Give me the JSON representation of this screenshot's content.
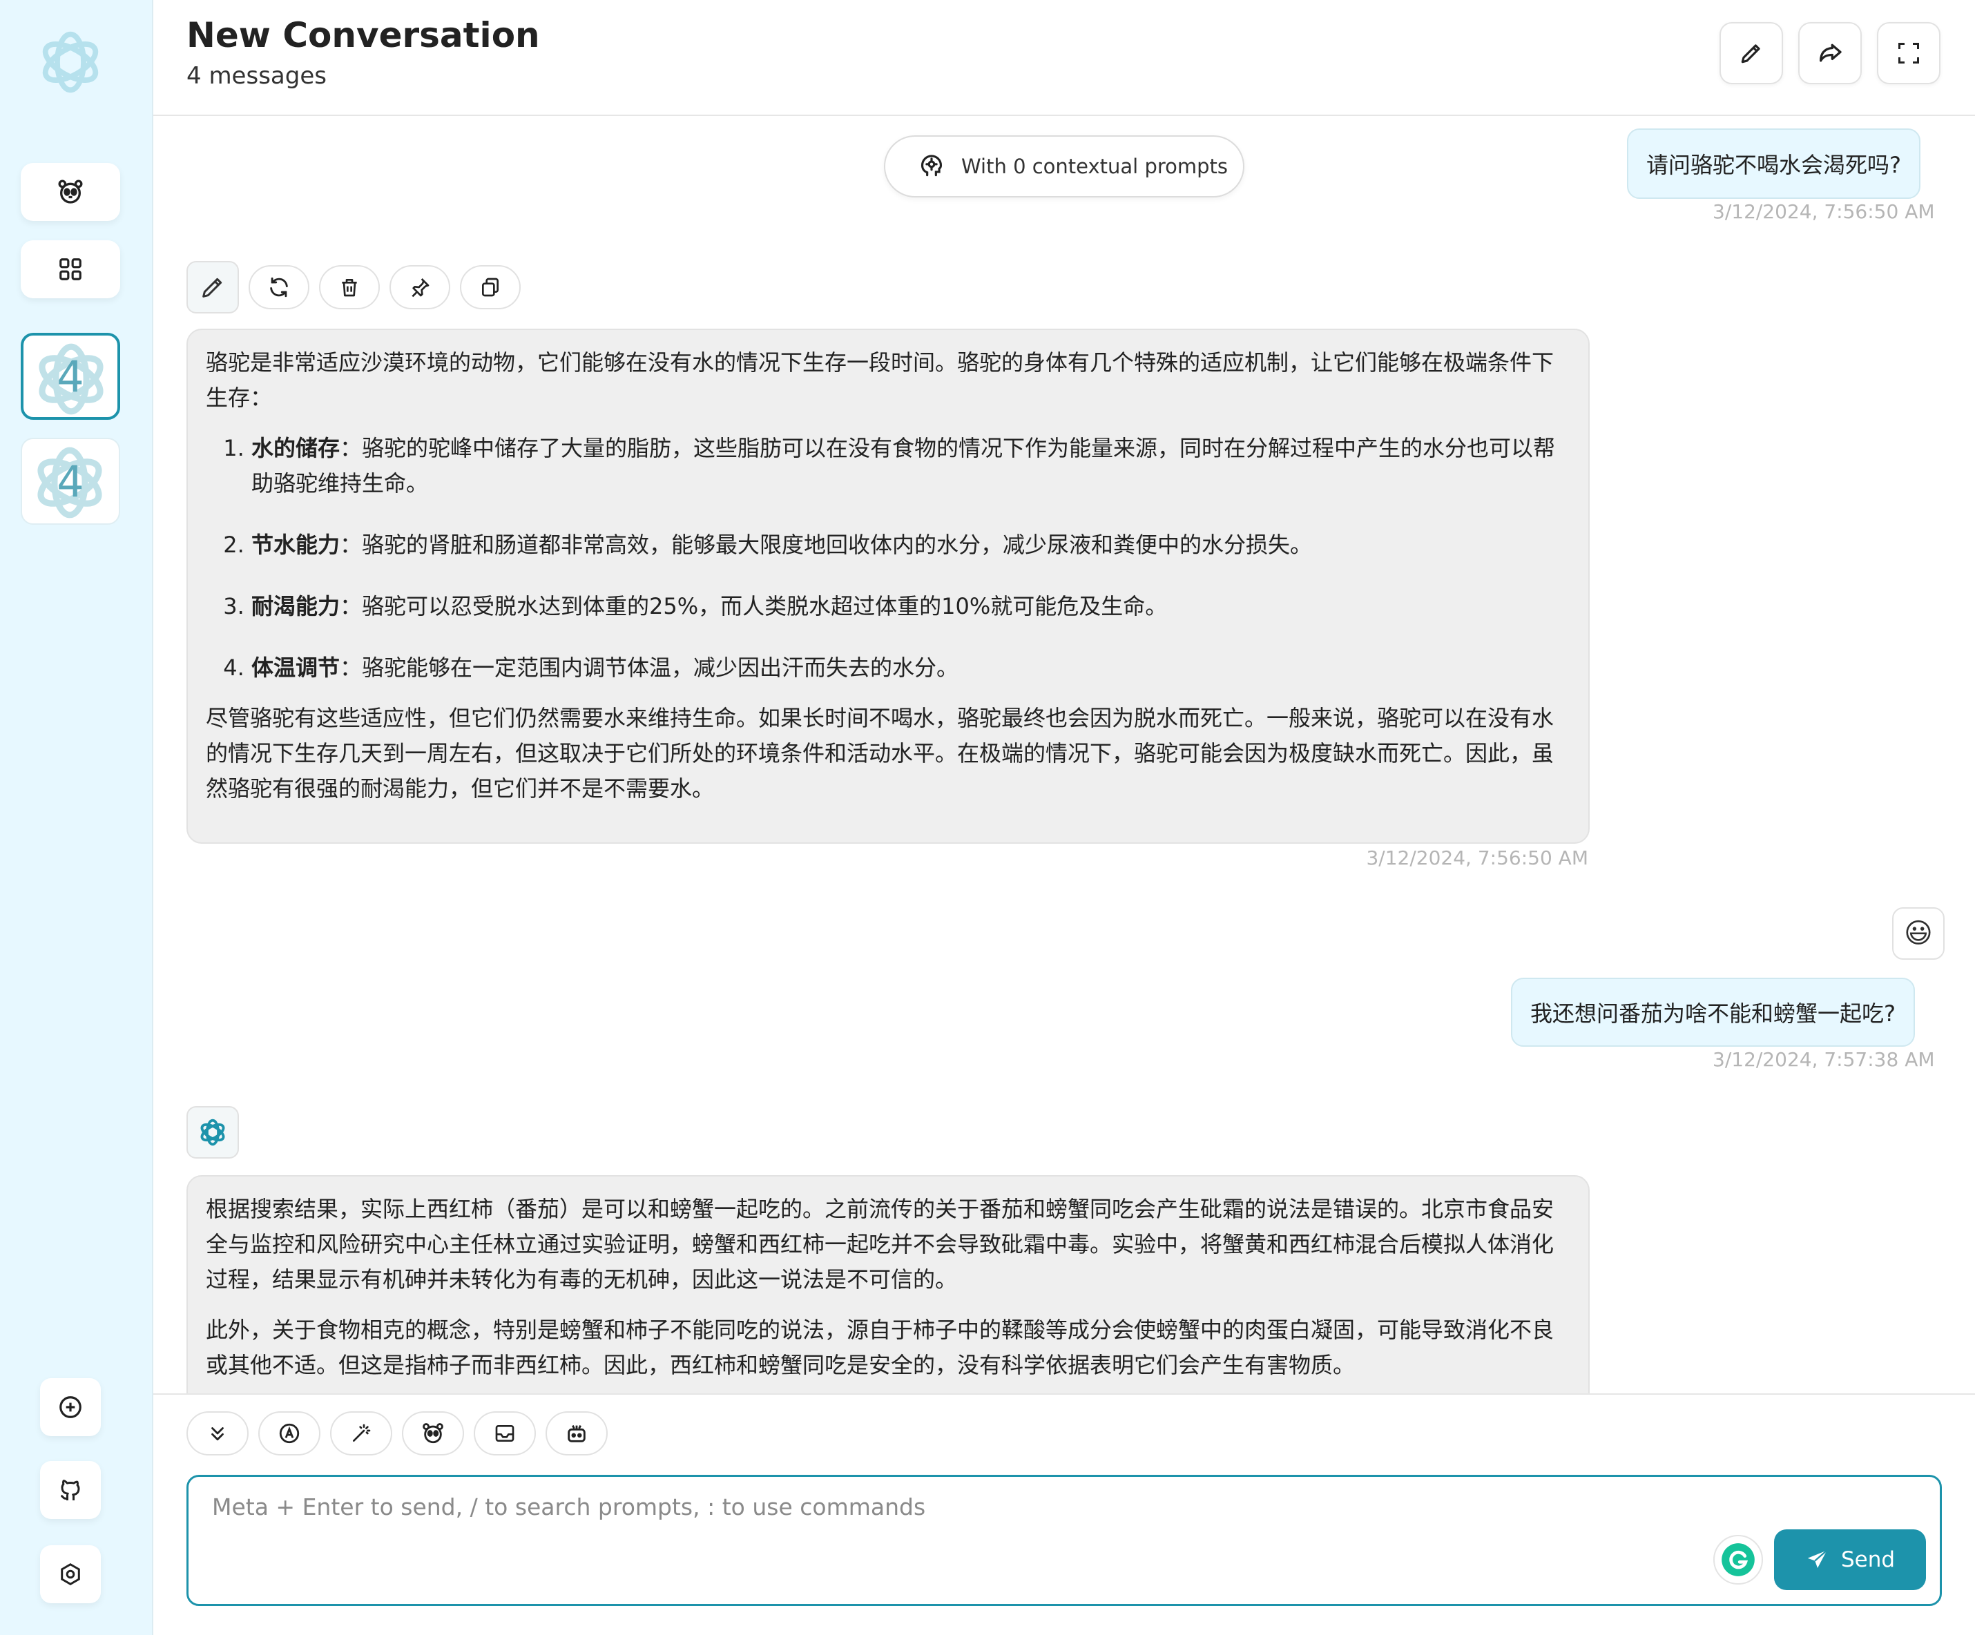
{
  "header": {
    "title": "New Conversation",
    "subtitle": "4 messages"
  },
  "sidebar": {
    "cards": [
      {
        "count": "4",
        "active": true
      },
      {
        "count": "4",
        "active": false
      }
    ]
  },
  "context": {
    "label": "With 0 contextual prompts"
  },
  "messages": [
    {
      "role": "user",
      "text": "请问骆驼不喝水会渴死吗?",
      "time": "3/12/2024, 7:56:50 AM"
    },
    {
      "role": "assistant",
      "intro": "骆驼是非常适应沙漠环境的动物，它们能够在没有水的情况下生存一段时间。骆驼的身体有几个特殊的适应机制，让它们能够在极端条件下生存：",
      "items": [
        {
          "title": "水的储存",
          "text": "：骆驼的驼峰中储存了大量的脂肪，这些脂肪可以在没有食物的情况下作为能量来源，同时在分解过程中产生的水分也可以帮助骆驼维持生命。"
        },
        {
          "title": "节水能力",
          "text": "：骆驼的肾脏和肠道都非常高效，能够最大限度地回收体内的水分，减少尿液和粪便中的水分损失。"
        },
        {
          "title": "耐渴能力",
          "text": "：骆驼可以忍受脱水达到体重的25%，而人类脱水超过体重的10%就可能危及生命。"
        },
        {
          "title": "体温调节",
          "text": "：骆驼能够在一定范围内调节体温，减少因出汗而失去的水分。"
        }
      ],
      "outro": "尽管骆驼有这些适应性，但它们仍然需要水来维持生命。如果长时间不喝水，骆驼最终也会因为脱水而死亡。一般来说，骆驼可以在没有水的情况下生存几天到一周左右，但这取决于它们所处的环境条件和活动水平。在极端的情况下，骆驼可能会因为极度缺水而死亡。因此，虽然骆驼有很强的耐渴能力，但它们并不是不需要水。",
      "time": "3/12/2024, 7:56:50 AM"
    },
    {
      "role": "user",
      "emoji": "😃",
      "text": "我还想问番茄为啥不能和螃蟹一起吃?",
      "time": "3/12/2024, 7:57:38 AM"
    },
    {
      "role": "assistant",
      "p1": "根据搜索结果，实际上西红柿（番茄）是可以和螃蟹一起吃的。之前流传的关于番茄和螃蟹同吃会产生砒霜的说法是错误的。北京市食品安全与监控和风险研究中心主任林立通过实验证明，螃蟹和西红柿一起吃并不会导致砒霜中毒。实验中，将蟹黄和西红柿混合后模拟人体消化过程，结果显示有机砷并未转化为有毒的无机砷，因此这一说法是不可信的。",
      "p2": "此外，关于食物相克的概念，特别是螃蟹和柿子不能同吃的说法，源自于柿子中的鞣酸等成分会使螃蟹中的肉蛋白凝固，可能导致消化不良或其他不适。但这是指柿子而非西红柿。因此，西红柿和螃蟹同吃是安全的，没有科学依据表明它们会产生有害物质。"
    }
  ],
  "input": {
    "placeholder": "Meta + Enter to send, / to search prompts, : to use commands",
    "send_label": "Send"
  },
  "colors": {
    "accent": "#1d93ab",
    "sidebar_bg": "#e7f8ff",
    "user_bubble": "#e7f8ff",
    "bot_bubble": "#efefef"
  }
}
